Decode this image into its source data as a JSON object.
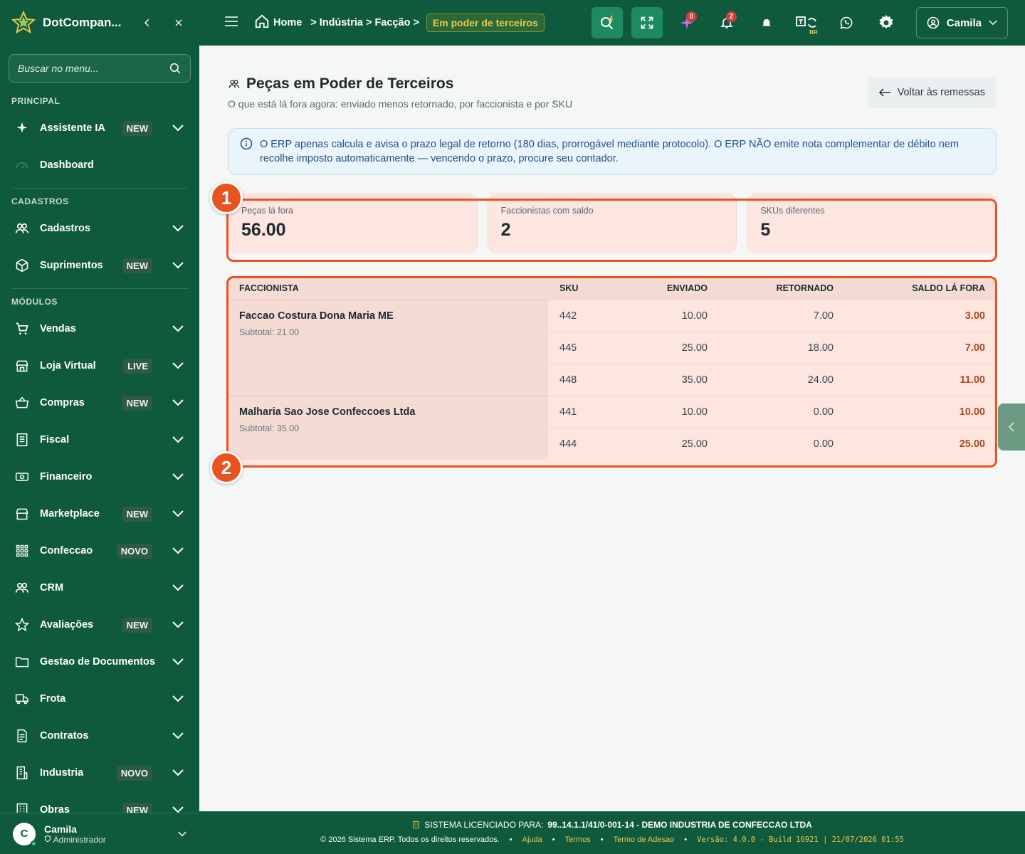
{
  "sidebar": {
    "brand": "DotCompan...",
    "search_placeholder": "Buscar no menu...",
    "sections": {
      "principal": "PRINCIPAL",
      "cadastros": "CADASTROS",
      "modulos": "MÓDULOS"
    },
    "items": [
      {
        "label": "Assistente IA",
        "badge": "NEW",
        "icon": "sparkle-icon"
      },
      {
        "label": "Dashboard",
        "badge": "",
        "icon": "gauge-icon"
      },
      {
        "label": "Cadastros",
        "badge": "",
        "icon": "users-icon"
      },
      {
        "label": "Suprimentos",
        "badge": "NEW",
        "icon": "box-icon"
      },
      {
        "label": "Vendas",
        "badge": "",
        "icon": "cart-icon"
      },
      {
        "label": "Loja Virtual",
        "badge": "LIVE",
        "icon": "store-icon"
      },
      {
        "label": "Compras",
        "badge": "NEW",
        "icon": "basket-icon"
      },
      {
        "label": "Fiscal",
        "badge": "",
        "icon": "receipt-icon"
      },
      {
        "label": "Financeiro",
        "badge": "",
        "icon": "cash-icon"
      },
      {
        "label": "Marketplace",
        "badge": "NEW",
        "icon": "shop-icon"
      },
      {
        "label": "Confeccao",
        "badge": "NOVO",
        "icon": "grid-icon"
      },
      {
        "label": "CRM",
        "badge": "",
        "icon": "users-icon"
      },
      {
        "label": "Avaliações",
        "badge": "NEW",
        "icon": "star-icon"
      },
      {
        "label": "Gestao de Documentos",
        "badge": "",
        "icon": "folder-icon"
      },
      {
        "label": "Frota",
        "badge": "",
        "icon": "truck-icon"
      },
      {
        "label": "Contratos",
        "badge": "",
        "icon": "document-icon"
      },
      {
        "label": "Industria",
        "badge": "NOVO",
        "icon": "factory-icon"
      },
      {
        "label": "Obras",
        "badge": "NEW",
        "icon": "building-icon"
      }
    ],
    "user": {
      "initial": "C",
      "name": "Camila",
      "role": "Administrador"
    }
  },
  "topbar": {
    "crumbs": [
      "Home",
      "Indústria",
      "Facção"
    ],
    "current": "Em poder de terceiros",
    "ai_count": "0",
    "notif_count": "2",
    "lang": "BR",
    "user": "Camila"
  },
  "page": {
    "title": "Peças em Poder de Terceiros",
    "subtitle": "O que está lá fora agora: enviado menos retornado, por faccionista e por SKU",
    "back_label": "Voltar às remessas",
    "alert": "O ERP apenas calcula e avisa o prazo legal de retorno (180 dias, prorrogável mediante protocolo). O ERP NÃO emite nota complementar de débito nem recolhe imposto automaticamente — vencendo o prazo, procure seu contador."
  },
  "kpis": [
    {
      "label": "Peças lá fora",
      "value": "56.00"
    },
    {
      "label": "Faccionistas com saldo",
      "value": "2"
    },
    {
      "label": "SKUs diferentes",
      "value": "5"
    }
  ],
  "table": {
    "headers": [
      "FACCIONISTA",
      "SKU",
      "ENVIADO",
      "RETORNADO",
      "SALDO LÁ FORA"
    ],
    "groups": [
      {
        "name": "Faccao Costura Dona Maria ME",
        "subtotal": "Subtotal: 21.00",
        "rows": [
          {
            "sku": "442",
            "enviado": "10.00",
            "retornado": "7.00",
            "saldo": "3.00"
          },
          {
            "sku": "445",
            "enviado": "25.00",
            "retornado": "18.00",
            "saldo": "7.00"
          },
          {
            "sku": "448",
            "enviado": "35.00",
            "retornado": "24.00",
            "saldo": "11.00"
          }
        ]
      },
      {
        "name": "Malharia Sao Jose Confeccoes Ltda",
        "subtotal": "Subtotal: 35.00",
        "rows": [
          {
            "sku": "441",
            "enviado": "10.00",
            "retornado": "0.00",
            "saldo": "10.00"
          },
          {
            "sku": "444",
            "enviado": "25.00",
            "retornado": "0.00",
            "saldo": "25.00"
          }
        ]
      }
    ]
  },
  "markers": [
    "1",
    "2"
  ],
  "footer": {
    "license_label": "SISTEMA LICENCIADO PARA:",
    "license_value": "99..14.1.1/41/0-001-14 - DEMO INDUSTRIA DE CONFECCAO LTDA",
    "copyright": "© 2026 Sistema ERP. Todos os direitos reservados.",
    "links": [
      "Ajuda",
      "Termos",
      "Termo de Adesao"
    ],
    "version": "Versão: 4.0.0 - Build 16921 | 21/07/2026 01:55"
  },
  "colors": {
    "sidebar": "#0f5a3c",
    "accent": "#e8541f",
    "highlight_text": "#f0c54a"
  }
}
